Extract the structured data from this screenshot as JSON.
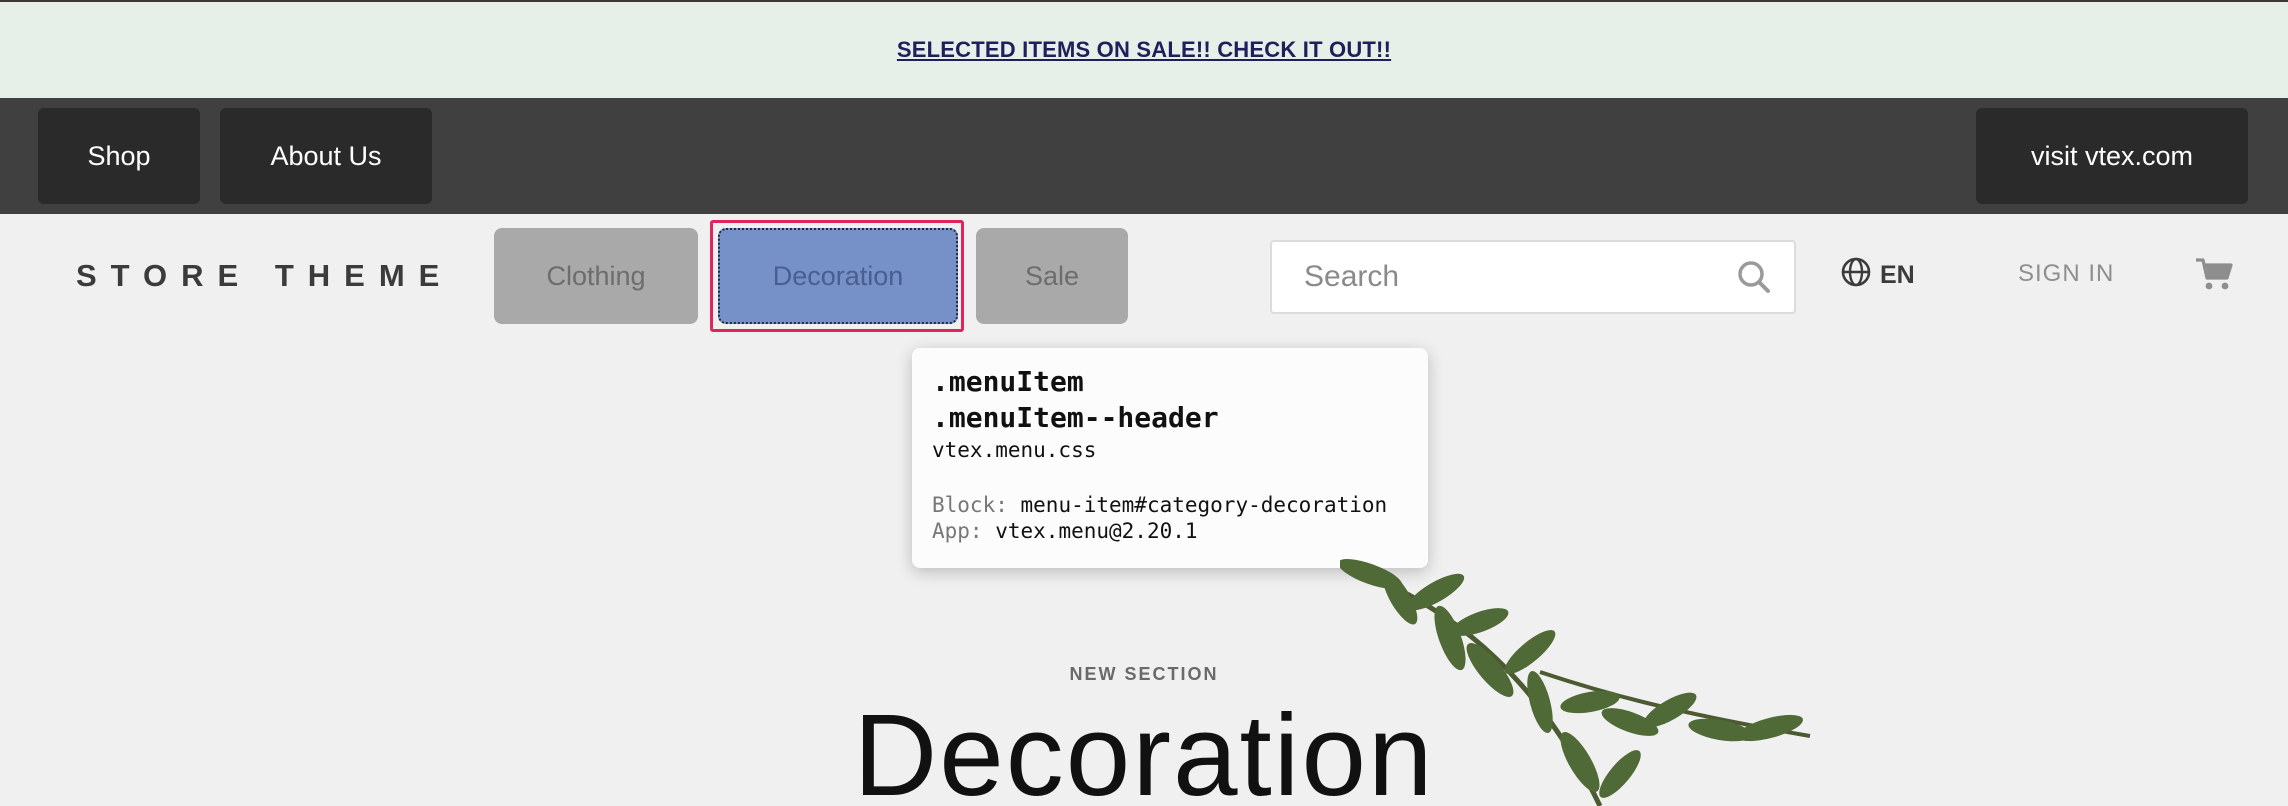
{
  "promo": {
    "text": "SELECTED ITEMS ON SALE!! CHECK IT OUT!!"
  },
  "top_nav": {
    "shop": "Shop",
    "about": "About Us",
    "visit": "visit vtex.com"
  },
  "header": {
    "logo": "STORE THEME",
    "categories": [
      "Clothing",
      "Decoration",
      "Sale"
    ],
    "search_placeholder": "Search",
    "language": "EN",
    "sign_in": "SIGN IN"
  },
  "tooltip": {
    "class_1": ".menuItem",
    "class_2": ".menuItem--header",
    "file": "vtex.menu.css",
    "block_key": "Block:",
    "block_value": "menu-item#category-decoration",
    "app_key": "App:",
    "app_value": "vtex.menu@2.20.1"
  },
  "hero": {
    "label": "NEW SECTION",
    "title": "Decoration"
  },
  "colors": {
    "highlight": "#e0245e",
    "selected_menu": "#7591c8",
    "promo_bg": "#e6f0e8",
    "nav_bg": "#404040"
  }
}
